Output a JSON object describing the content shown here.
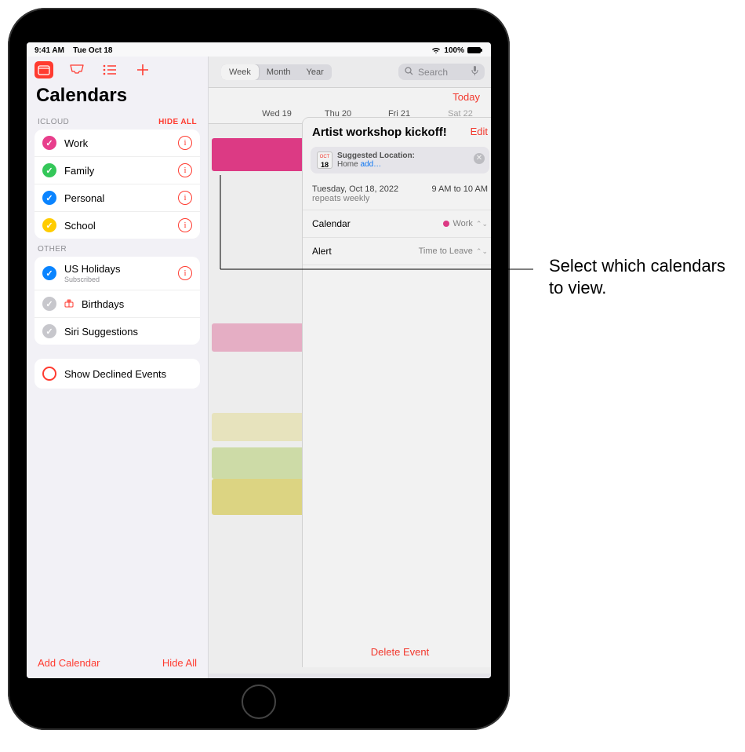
{
  "status": {
    "time": "9:41 AM",
    "date": "Tue Oct 18",
    "battery": "100%"
  },
  "sidebar": {
    "title": "Calendars",
    "sections": {
      "icloud": {
        "label": "ICLOUD",
        "hide": "HIDE ALL",
        "items": [
          {
            "label": "Work",
            "color": "#e83e8c",
            "checked": true
          },
          {
            "label": "Family",
            "color": "#34c759",
            "checked": true
          },
          {
            "label": "Personal",
            "color": "#0a84ff",
            "checked": true
          },
          {
            "label": "School",
            "color": "#ffcc00",
            "checked": true
          }
        ]
      },
      "other": {
        "label": "OTHER",
        "items": [
          {
            "label": "US Holidays",
            "sub": "Subscribed",
            "color": "#0a84ff",
            "checked": true,
            "info": true
          },
          {
            "label": "Birthdays",
            "gray": true,
            "checked": true,
            "icon": "gift"
          },
          {
            "label": "Siri Suggestions",
            "gray": true,
            "checked": true
          }
        ]
      }
    },
    "declined": "Show Declined Events",
    "footer": {
      "add": "Add Calendar",
      "hide": "Hide All"
    }
  },
  "main": {
    "segments": [
      "Week",
      "Month",
      "Year"
    ],
    "active_segment": "Week",
    "search_placeholder": "Search",
    "today": "Today",
    "week": [
      "Wed 19",
      "Thu 20",
      "Fri 21",
      "Sat 22"
    ]
  },
  "event": {
    "title": "Artist workshop kickoff!",
    "edit": "Edit",
    "suggest_label": "Suggested Location:",
    "suggest_home": "Home",
    "suggest_add": "add…",
    "suggest_icon_day": "18",
    "date_line": "Tuesday, Oct 18, 2022",
    "repeat": "repeats weekly",
    "time_range": "9 AM to 10 AM",
    "calendar_label": "Calendar",
    "calendar_value": "Work",
    "alert_label": "Alert",
    "alert_value": "Time to Leave",
    "delete": "Delete Event"
  },
  "callout": "Select which calendars to view."
}
